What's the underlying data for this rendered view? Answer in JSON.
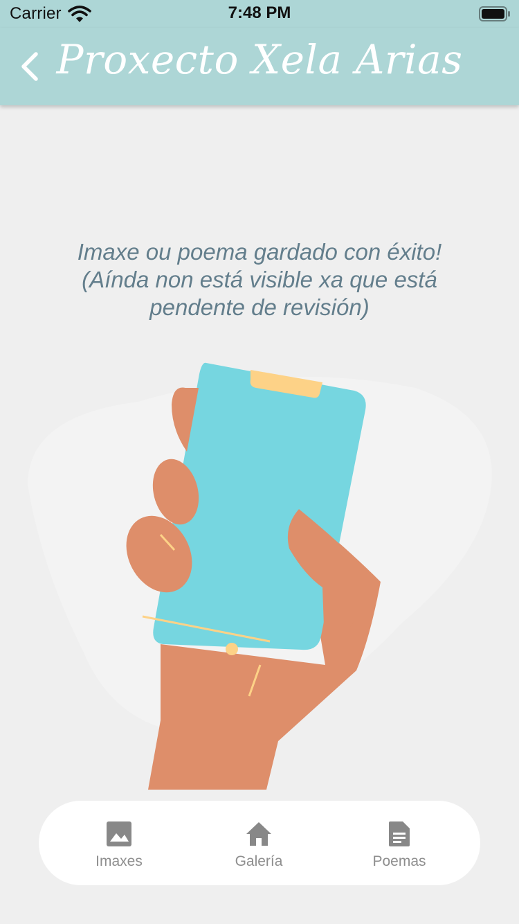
{
  "status_bar": {
    "carrier": "Carrier",
    "time": "7:48 PM",
    "wifi_icon": "wifi-icon",
    "battery_icon": "battery-icon"
  },
  "header": {
    "title": "Proxecto Xela Arias",
    "back_icon": "chevron-left-icon",
    "background_color": "#add6d6",
    "title_color": "#ffffff"
  },
  "message": {
    "line1": "Imaxe ou poema gardado con éxito!",
    "line2": "(Aínda non está visible xa que está",
    "line3": "pendente de revisión)",
    "color": "#637e8c"
  },
  "illustration": {
    "subject": "hand-holding-phone",
    "phone_color": "#76d6e0",
    "hand_color": "#de8e6a",
    "accent_color": "#fdd287"
  },
  "bottom_nav": {
    "tabs": [
      {
        "label": "Imaxes",
        "icon": "image-icon"
      },
      {
        "label": "Galería",
        "icon": "home-icon"
      },
      {
        "label": "Poemas",
        "icon": "document-icon"
      }
    ],
    "label_color": "#8e8e8e",
    "icon_color": "#888888"
  }
}
